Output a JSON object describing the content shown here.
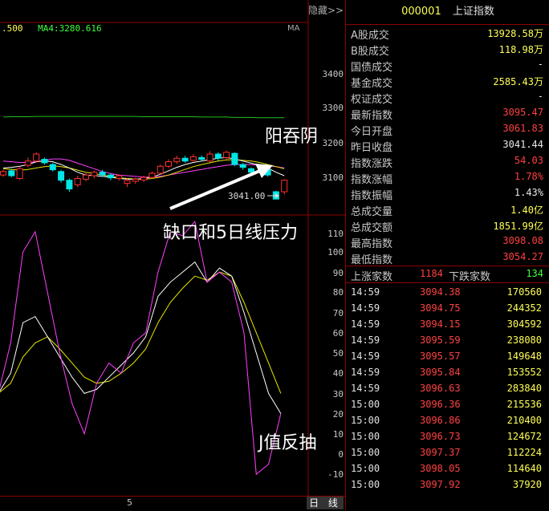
{
  "toolbar": {
    "hide_label": "隐藏>>",
    "ma_tag": "MA"
  },
  "ma_legend": {
    "ma_partial": ".500",
    "ma4": "MA4:3280.616"
  },
  "price_axis": [
    "3400",
    "3300",
    "3200",
    "3100"
  ],
  "kdj_axis": [
    "110",
    "100",
    "90",
    "80",
    "70",
    "60",
    "50",
    "40",
    "30",
    "20",
    "10",
    "0",
    "-10"
  ],
  "low_marker": "3041.00",
  "annotations": {
    "engulf": "阳吞阴",
    "gap": "缺口和5日线压力",
    "j_value": "J值反抽"
  },
  "bottom": {
    "date_label": "5",
    "period_button": "日 线"
  },
  "index": {
    "code": "000001",
    "name": "上证指数"
  },
  "stats": [
    {
      "label": "A股成交",
      "value": "13928.58万",
      "color": "yellow"
    },
    {
      "label": "B股成交",
      "value": "118.98万",
      "color": "yellow"
    },
    {
      "label": "国债成交",
      "value": "-",
      "color": "white"
    },
    {
      "label": "基金成交",
      "value": "2585.43万",
      "color": "yellow"
    },
    {
      "label": "权证成交",
      "value": "-",
      "color": "white"
    },
    {
      "label": "最新指数",
      "value": "3095.47",
      "color": "red"
    },
    {
      "label": "今日开盘",
      "value": "3061.83",
      "color": "red"
    },
    {
      "label": "昨日收盘",
      "value": "3041.44",
      "color": "white"
    },
    {
      "label": "指数涨跌",
      "value": "54.03",
      "color": "red"
    },
    {
      "label": "指数涨幅",
      "value": "1.78%",
      "color": "red"
    },
    {
      "label": "指数振幅",
      "value": "1.43%",
      "color": "white"
    },
    {
      "label": "总成交量",
      "value": "1.40亿",
      "color": "yellow"
    },
    {
      "label": "总成交额",
      "value": "1851.99亿",
      "color": "yellow"
    },
    {
      "label": "最高指数",
      "value": "3098.08",
      "color": "red"
    },
    {
      "label": "最低指数",
      "value": "3054.27",
      "color": "red"
    }
  ],
  "breadth": {
    "up_label": "上涨家数",
    "up_value": "1184",
    "down_label": "下跌家数",
    "down_value": "134"
  },
  "ticks": [
    {
      "time": "14:59",
      "price": "3094.38",
      "volume": "170560"
    },
    {
      "time": "14:59",
      "price": "3094.75",
      "volume": "244352"
    },
    {
      "time": "14:59",
      "price": "3094.15",
      "volume": "304592"
    },
    {
      "time": "14:59",
      "price": "3095.59",
      "volume": "238080"
    },
    {
      "time": "14:59",
      "price": "3095.57",
      "volume": "149648"
    },
    {
      "time": "14:59",
      "price": "3095.84",
      "volume": "153552"
    },
    {
      "time": "14:59",
      "price": "3096.63",
      "volume": "283840"
    },
    {
      "time": "15:00",
      "price": "3096.36",
      "volume": "215536"
    },
    {
      "time": "15:00",
      "price": "3096.86",
      "volume": "210400"
    },
    {
      "time": "15:00",
      "price": "3096.73",
      "volume": "124672"
    },
    {
      "time": "15:00",
      "price": "3097.37",
      "volume": "112224"
    },
    {
      "time": "15:00",
      "price": "3098.05",
      "volume": "114640"
    },
    {
      "time": "15:00",
      "price": "3097.92",
      "volume": "37920"
    }
  ],
  "colors": {
    "up": "#ff3030",
    "down": "#00e5e5",
    "ma_white": "#ffffff",
    "ma_yellow": "#e6e600",
    "ma_magenta": "#ff40ff",
    "ma_green": "#20c020",
    "frame": "#8b0000"
  },
  "candles": [
    {
      "o": 3110,
      "c": 3120,
      "h": 3125,
      "l": 3105
    },
    {
      "o": 3122,
      "c": 3108,
      "h": 3128,
      "l": 3104
    },
    {
      "o": 3100,
      "c": 3128,
      "h": 3134,
      "l": 3096
    },
    {
      "o": 3138,
      "c": 3150,
      "h": 3160,
      "l": 3132
    },
    {
      "o": 3150,
      "c": 3170,
      "h": 3175,
      "l": 3145
    },
    {
      "o": 3155,
      "c": 3145,
      "h": 3160,
      "l": 3140
    },
    {
      "o": 3140,
      "c": 3125,
      "h": 3145,
      "l": 3120
    },
    {
      "o": 3120,
      "c": 3095,
      "h": 3125,
      "l": 3088
    },
    {
      "o": 3095,
      "c": 3070,
      "h": 3100,
      "l": 3062
    },
    {
      "o": 3082,
      "c": 3100,
      "h": 3108,
      "l": 3075
    },
    {
      "o": 3098,
      "c": 3110,
      "h": 3118,
      "l": 3092
    },
    {
      "o": 3108,
      "c": 3118,
      "h": 3123,
      "l": 3100
    },
    {
      "o": 3118,
      "c": 3110,
      "h": 3125,
      "l": 3104
    },
    {
      "o": 3110,
      "c": 3102,
      "h": 3115,
      "l": 3095
    },
    {
      "o": 3100,
      "c": 3108,
      "h": 3112,
      "l": 3094
    },
    {
      "o": 3086,
      "c": 3094,
      "h": 3100,
      "l": 3076
    },
    {
      "o": 3092,
      "c": 3098,
      "h": 3102,
      "l": 3085
    },
    {
      "o": 3096,
      "c": 3103,
      "h": 3108,
      "l": 3090
    },
    {
      "o": 3103,
      "c": 3115,
      "h": 3120,
      "l": 3100
    },
    {
      "o": 3115,
      "c": 3135,
      "h": 3140,
      "l": 3110
    },
    {
      "o": 3135,
      "c": 3148,
      "h": 3155,
      "l": 3130
    },
    {
      "o": 3148,
      "c": 3158,
      "h": 3165,
      "l": 3142
    },
    {
      "o": 3158,
      "c": 3150,
      "h": 3165,
      "l": 3145
    },
    {
      "o": 3152,
      "c": 3162,
      "h": 3170,
      "l": 3148
    },
    {
      "o": 3160,
      "c": 3155,
      "h": 3166,
      "l": 3150
    },
    {
      "o": 3150,
      "c": 3170,
      "h": 3178,
      "l": 3146
    },
    {
      "o": 3170,
      "c": 3158,
      "h": 3175,
      "l": 3150
    },
    {
      "o": 3160,
      "c": 3175,
      "h": 3180,
      "l": 3155
    },
    {
      "o": 3172,
      "c": 3140,
      "h": 3175,
      "l": 3135
    },
    {
      "o": 3140,
      "c": 3132,
      "h": 3145,
      "l": 3125
    },
    {
      "o": 3128,
      "c": 3118,
      "h": 3132,
      "l": 3112
    },
    {
      "o": 3120,
      "c": 3122,
      "h": 3125,
      "l": 3115
    },
    {
      "o": 3125,
      "c": 3110,
      "h": 3132,
      "l": 3105
    },
    {
      "o": 3062,
      "c": 3041,
      "h": 3065,
      "l": 3040
    },
    {
      "o": 3062,
      "c": 3095,
      "h": 3098,
      "l": 3054
    }
  ],
  "ma_lines": {
    "white": [
      3130,
      3132,
      3135,
      3140,
      3148,
      3150,
      3148,
      3140,
      3130,
      3118,
      3110,
      3108,
      3106,
      3104,
      3100,
      3098,
      3098,
      3100,
      3104,
      3112,
      3122,
      3132,
      3140,
      3146,
      3150,
      3154,
      3158,
      3160,
      3156,
      3150,
      3144,
      3138,
      3130,
      3118,
      3108
    ],
    "yellow": [
      3128,
      3126,
      3124,
      3126,
      3130,
      3134,
      3136,
      3134,
      3130,
      3124,
      3118,
      3114,
      3110,
      3106,
      3102,
      3100,
      3098,
      3098,
      3100,
      3104,
      3110,
      3118,
      3126,
      3134,
      3140,
      3145,
      3150,
      3153,
      3154,
      3152,
      3150,
      3146,
      3140,
      3134,
      3128
    ],
    "magenta": [
      3150,
      3148,
      3146,
      3146,
      3148,
      3152,
      3156,
      3156,
      3152,
      3144,
      3136,
      3128,
      3120,
      3114,
      3110,
      3108,
      3106,
      3104,
      3104,
      3106,
      3110,
      3114,
      3118,
      3122,
      3126,
      3130,
      3134,
      3138,
      3140,
      3140,
      3140,
      3138,
      3136,
      3134,
      3130
    ],
    "green": [
      3276,
      3277,
      3277,
      3277,
      3278,
      3278,
      3278,
      3278,
      3278,
      3278,
      3278,
      3278,
      3278,
      3278,
      3278,
      3278,
      3278,
      3277,
      3277,
      3277,
      3277,
      3277,
      3277,
      3277,
      3276,
      3276,
      3276,
      3276,
      3275,
      3275,
      3275,
      3274,
      3274,
      3274,
      3274
    ]
  },
  "kdj": {
    "j": [
      30,
      55,
      100,
      110,
      80,
      50,
      25,
      10,
      35,
      45,
      40,
      55,
      60,
      90,
      110,
      108,
      115,
      85,
      90,
      85,
      60,
      -10,
      -5,
      20
    ],
    "k": [
      30,
      40,
      65,
      68,
      58,
      48,
      38,
      30,
      32,
      38,
      44,
      50,
      58,
      78,
      85,
      90,
      95,
      85,
      92,
      88,
      70,
      50,
      30,
      20
    ],
    "d": [
      30,
      35,
      48,
      55,
      58,
      52,
      45,
      38,
      35,
      36,
      40,
      45,
      52,
      65,
      75,
      82,
      88,
      86,
      90,
      88,
      75,
      60,
      45,
      30
    ]
  }
}
